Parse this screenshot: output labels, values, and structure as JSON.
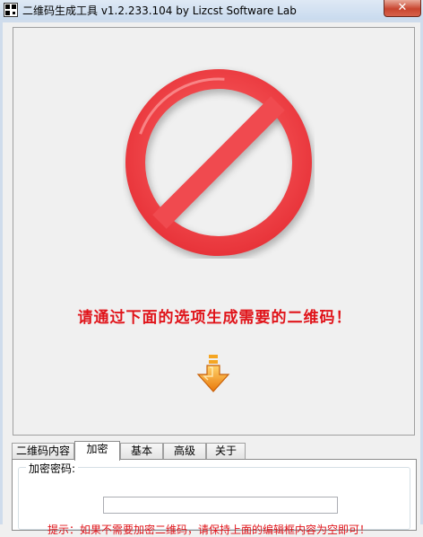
{
  "window": {
    "title": "二维码生成工具 v1.2.233.104    by Lizcst Software Lab",
    "close_label": "✕"
  },
  "preview": {
    "message": "请通过下面的选项生成需要的二维码！"
  },
  "tabs": [
    {
      "label": "二维码内容",
      "active": false
    },
    {
      "label": "加密",
      "active": true
    },
    {
      "label": "基本",
      "active": false
    },
    {
      "label": "高级",
      "active": false
    },
    {
      "label": "关于",
      "active": false
    }
  ],
  "encryption": {
    "group_label": "加密密码:",
    "password_value": "",
    "hint": "提示：如果不需要加密二维码，请保持上面的编辑框内容为空即可！"
  },
  "colors": {
    "accent_red": "#e0141a",
    "arrow_orange": "#f39a12"
  },
  "icons": {
    "forbidden": "forbidden-icon",
    "down_arrow": "down-arrow-icon",
    "app": "qr-app-icon"
  }
}
